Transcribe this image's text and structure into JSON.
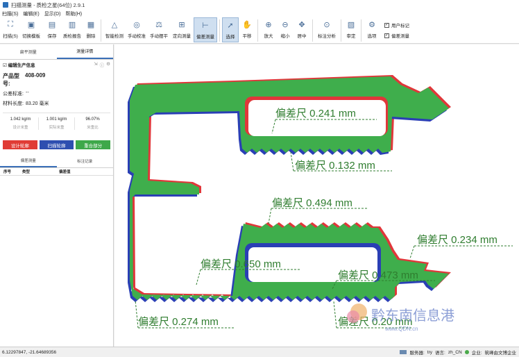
{
  "title": "扫描测量 - 质检之星(64位) 2.9.1",
  "menu": [
    "扫描(S)",
    "编辑(E)",
    "显示(D)",
    "帮助(H)"
  ],
  "toolbar": {
    "group1": [
      {
        "label": "扫描(S)",
        "icon": "scan-icon"
      },
      {
        "label": "切换模板",
        "icon": "template-icon"
      },
      {
        "label": "保存",
        "icon": "save-icon"
      },
      {
        "label": "质检报告",
        "icon": "report-icon"
      },
      {
        "label": "删除",
        "icon": "delete-icon"
      }
    ],
    "group2": [
      {
        "label": "智能检测",
        "icon": "smart-detect-icon"
      },
      {
        "label": "手动校准",
        "icon": "calibrate-icon"
      },
      {
        "label": "手动摆平",
        "icon": "level-icon"
      },
      {
        "label": "定向测量",
        "icon": "measure-icon"
      },
      {
        "label": "偏差测量",
        "icon": "deviation-icon",
        "active": true
      }
    ],
    "group3": [
      {
        "label": "选择",
        "icon": "cursor-icon",
        "active": true
      },
      {
        "label": "平移",
        "icon": "hand-icon"
      },
      {
        "label": "放大",
        "icon": "zoom-in-icon"
      },
      {
        "label": "缩小",
        "icon": "zoom-out-icon"
      },
      {
        "label": "居中",
        "icon": "center-icon"
      },
      {
        "label": "标注分析",
        "icon": "annotate-icon"
      },
      {
        "label": "审定",
        "icon": "approve-icon"
      },
      {
        "label": "选项",
        "icon": "options-icon"
      }
    ],
    "checks": [
      {
        "label": "用户标记",
        "checked": true
      },
      {
        "label": "偏差测量",
        "checked": true
      }
    ]
  },
  "left": {
    "tabs": [
      "扁平测量",
      "测量详情"
    ],
    "info_title": "编辑生产信息",
    "product_label": "产品型号:",
    "product_value": "408-009",
    "std_label": "公差标准:",
    "std_value": "--",
    "len_label": "材料长度:",
    "len_value": "83.20 毫米",
    "stats": [
      {
        "value": "1.042 kg/m",
        "label": "设计米重"
      },
      {
        "value": "1.001 kg/m",
        "label": "实际米重"
      },
      {
        "value": "96.07%",
        "label": "米重比"
      }
    ],
    "buttons": [
      "设计轮廓",
      "扫描轮廓",
      "重合部分"
    ],
    "button_colors": [
      "#e03c35",
      "#2e4fb0",
      "#3ea84a"
    ],
    "tabs2": [
      "偏差测量",
      "标注记录"
    ],
    "table_headers": [
      "序号",
      "类型",
      "偏差值"
    ]
  },
  "canvas": {
    "labels": [
      "偏差尺 0.241 mm",
      "偏差尺 0.132 mm",
      "偏差尺 0.494 mm",
      "偏差尺 0.234 mm",
      "偏差尺 0.650 mm",
      "偏差尺 0.473 mm",
      "偏差尺 0.274 mm",
      "偏差尺 0.20 mm"
    ],
    "fill_color": "#3fae4c",
    "design_color": "#e0373a",
    "scan_color": "#2a3fb5",
    "label_color": "#2f7d2f",
    "watermark": "黔东南信息港",
    "watermark_sub": "www.QDN.cn"
  },
  "status": {
    "coords": "6.12297847, -21.64689356",
    "server_label": "服务器:",
    "server_value": "try",
    "lang_label": "语言:",
    "lang_value": "zh_CN",
    "company_label": "企业:",
    "company_value": "筑峰由文博企业"
  }
}
